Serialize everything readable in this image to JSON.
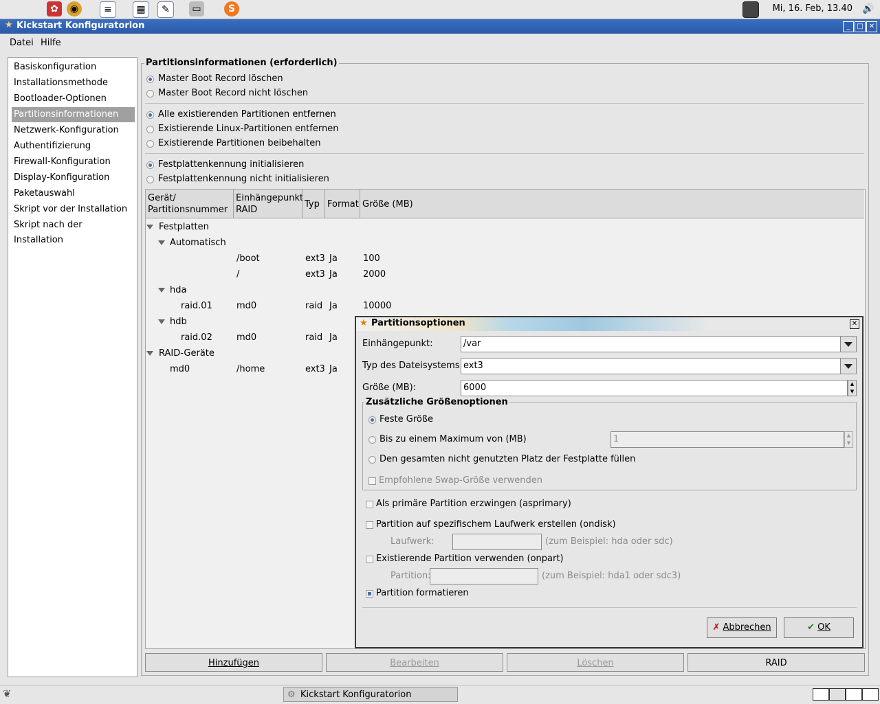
{
  "panel": {
    "clock": "Mi, 16. Feb, 13.40",
    "icons": [
      "gnome-foot-icon",
      "compass-icon",
      "document-icon",
      "spreadsheet-icon",
      "presentation-icon",
      "printer-icon",
      "skype-icon"
    ]
  },
  "window": {
    "title": "Kickstart Konfiguratorion",
    "menu": [
      "Datei",
      "Hilfe"
    ]
  },
  "sidebar": {
    "items": [
      "Basiskonfiguration",
      "Installationsmethode",
      "Bootloader-Optionen",
      "Partitionsinformationen",
      "Netzwerk-Konfiguration",
      "Authentifizierung",
      "Firewall-Konfiguration",
      "Display-Konfiguration",
      "Paketauswahl",
      "Skript vor der Installation",
      "Skript nach der Installation"
    ],
    "selected_index": 3
  },
  "main": {
    "frame_title": "Partitionsinformationen (erforderlich)",
    "mbr": [
      "Master Boot Record löschen",
      "Master Boot Record nicht löschen"
    ],
    "partitions": [
      "Alle existierenden Partitionen entfernen",
      "Existierende Linux-Partitionen entfernen",
      "Existierende Partitionen beibehalten"
    ],
    "disklabel": [
      "Festplattenkennung initialisieren",
      "Festplattenkennung nicht initialisieren"
    ],
    "columns": {
      "device": "Gerät/\nPartitionsnummer",
      "mount": "Einhängepunkt/\nRAID",
      "type": "Typ",
      "format": "Format",
      "size": "Größe (MB)"
    },
    "tree": {
      "festplatten": "Festplatten",
      "automatisch": "Automatisch",
      "auto_rows": [
        {
          "mount": "/boot",
          "type": "ext3",
          "format": "Ja",
          "size": "100"
        },
        {
          "mount": "/",
          "type": "ext3",
          "format": "Ja",
          "size": "2000"
        }
      ],
      "hda": "hda",
      "hda_row": {
        "device": "raid.01",
        "mount": "md0",
        "type": "raid",
        "format": "Ja",
        "size": "10000"
      },
      "hdb": "hdb",
      "hdb_row": {
        "device": "raid.02",
        "mount": "md0",
        "type": "raid",
        "format": "Ja"
      },
      "raid": "RAID-Geräte",
      "raid_row": {
        "device": "md0",
        "mount": "/home",
        "type": "ext3",
        "format": "Ja"
      }
    },
    "buttons": {
      "add": "Hinzufügen",
      "edit": "Bearbeiten",
      "delete": "Löschen",
      "raid": "RAID"
    }
  },
  "dialog": {
    "title": "Partitionsoptionen",
    "mount_label": "Einhängepunkt:",
    "mount_value": "/var",
    "fstype_label": "Typ des Dateisystems:",
    "fstype_value": "ext3",
    "size_label": "Größe (MB):",
    "size_value": "6000",
    "extra_title": "Zusätzliche Größenoptionen",
    "fixed": "Feste Größe",
    "maximum": "Bis zu einem Maximum von (MB)",
    "maximum_value": "1",
    "fill": "Den gesamten nicht genutzten Platz der Festplatte füllen",
    "swap": "Empfohlene Swap-Größe verwenden",
    "asprimary": "Als primäre Partition erzwingen (asprimary)",
    "ondisk": "Partition auf spezifischem Laufwerk erstellen (ondisk)",
    "drive_label": "Laufwerk:",
    "drive_hint": "(zum Beispiel: hda oder sdc)",
    "onpart": "Existierende Partition verwenden (onpart)",
    "part_label": "Partition:",
    "part_hint": "(zum Beispiel: hda1 oder sdc3)",
    "format": "Partition formatieren",
    "cancel": "Abbrechen",
    "ok": "OK"
  },
  "taskbar": {
    "task": "Kickstart Konfiguratorion"
  }
}
